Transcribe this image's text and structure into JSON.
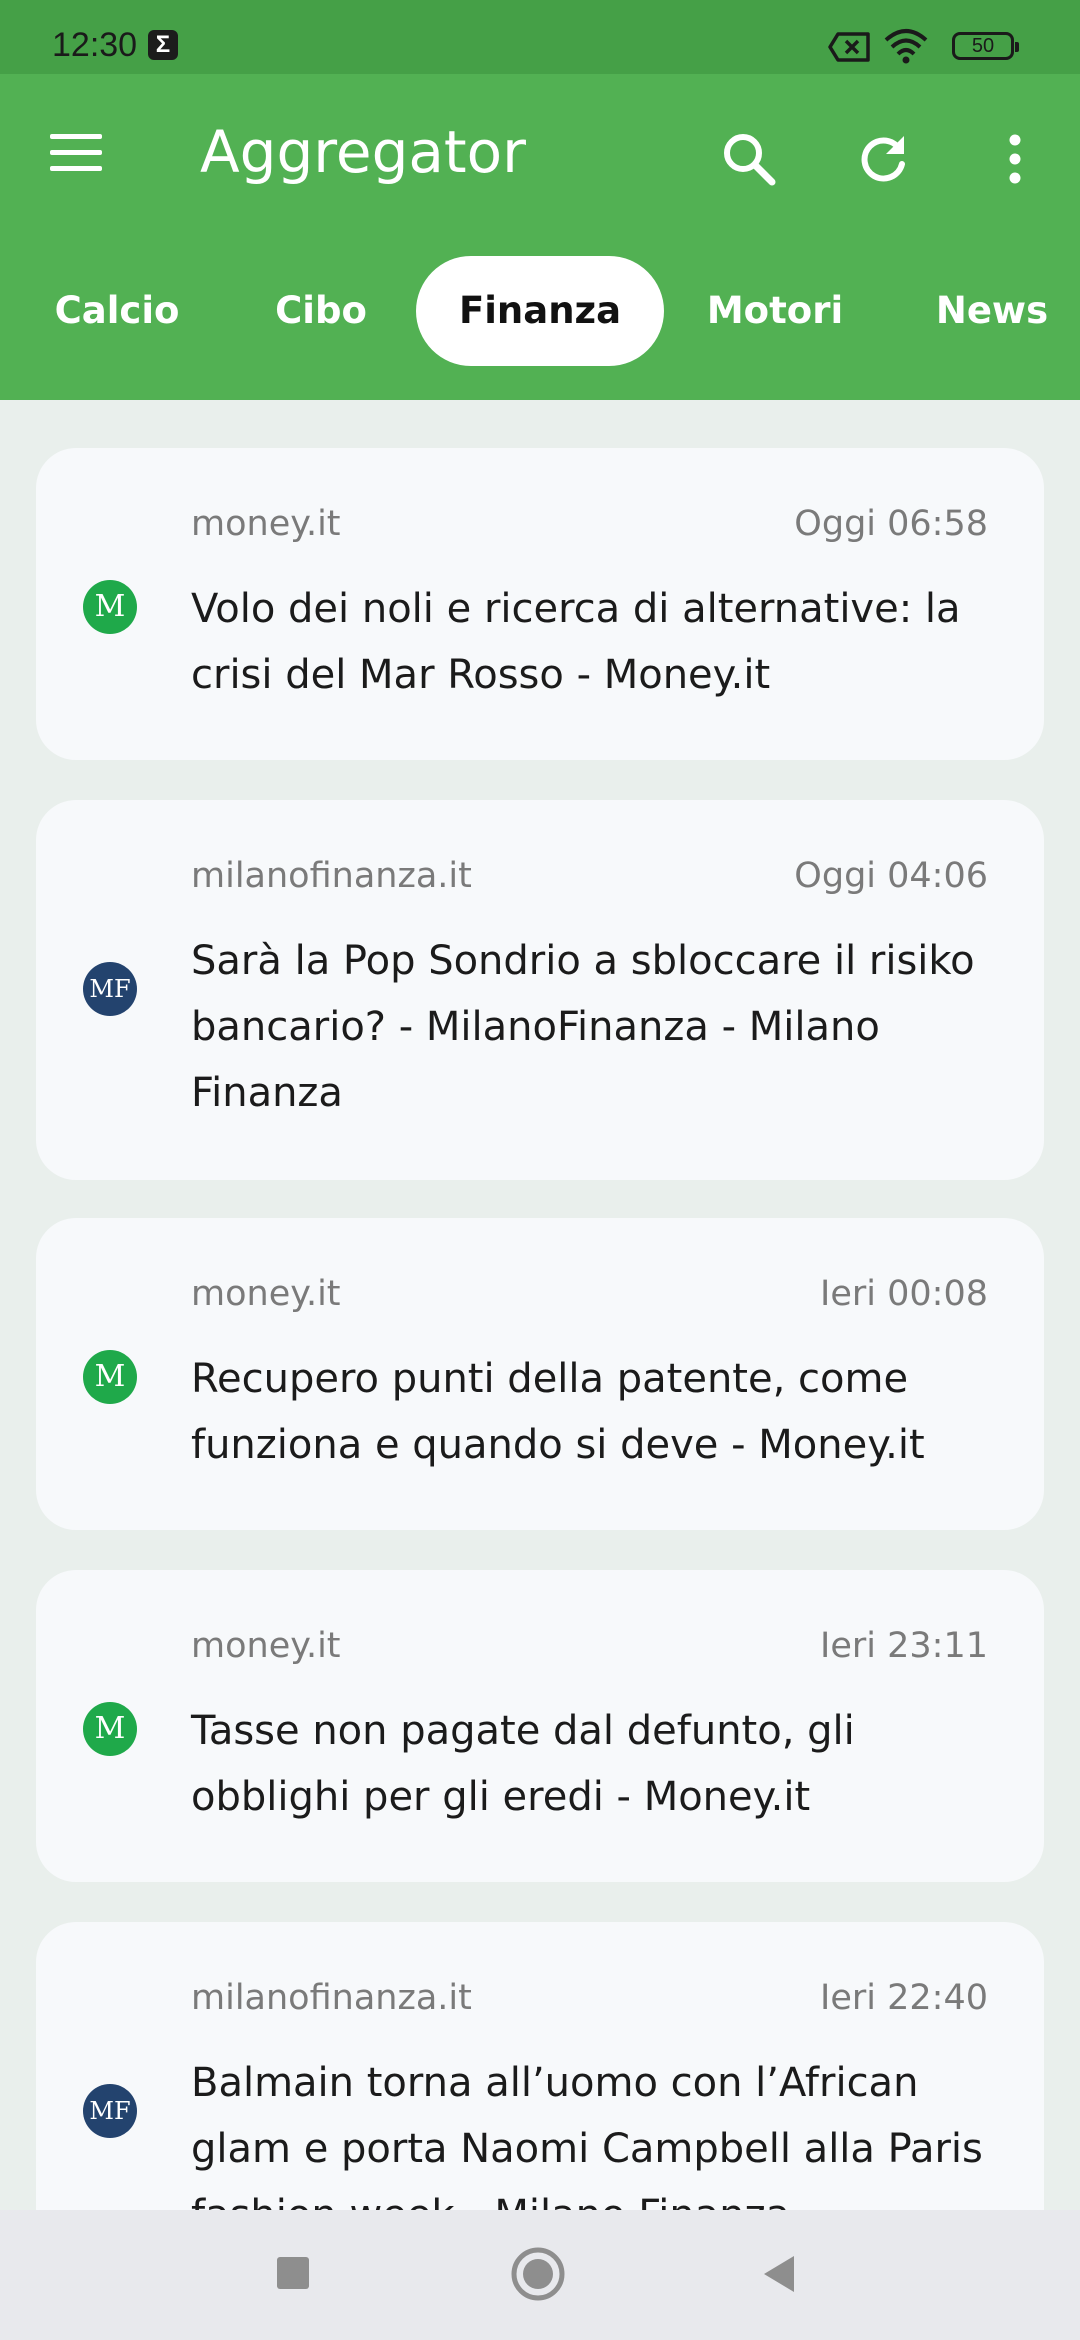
{
  "status_bar": {
    "time": "12:30",
    "battery": "50"
  },
  "app_bar": {
    "title": "Aggregator"
  },
  "tabs": [
    {
      "label": "Calcio",
      "selected": false
    },
    {
      "label": "Cibo",
      "selected": false
    },
    {
      "label": "Finanza",
      "selected": true
    },
    {
      "label": "Motori",
      "selected": false
    },
    {
      "label": "News",
      "selected": false
    }
  ],
  "articles": [
    {
      "source": "money.it",
      "date": "Oggi 06:58",
      "title": "Volo dei noli e ricerca di alternative: la crisi del Mar Rosso - Money.it",
      "logo": "M"
    },
    {
      "source": "milanofinanza.it",
      "date": "Oggi 04:06",
      "title": "Sarà la Pop Sondrio a sbloccare il risiko bancario? - MilanoFinanza - Milano Finanza",
      "logo": "MF"
    },
    {
      "source": "money.it",
      "date": "Ieri 00:08",
      "title": "Recupero punti della patente, come funziona e quando si deve - Money.it",
      "logo": "M"
    },
    {
      "source": "money.it",
      "date": "Ieri 23:11",
      "title": "Tasse non pagate dal defunto, gli obblighi per gli eredi - Money.it",
      "logo": "M"
    },
    {
      "source": "milanofinanza.it",
      "date": "Ieri 22:40",
      "title": "Balmain torna all’uomo con l’African glam e porta Naomi Campbell alla Paris fashion week - Milano Finanza",
      "logo": "MF"
    }
  ],
  "colors": {
    "app_bar": "#52b153",
    "status_bar": "#45a047",
    "money_logo": "#1fa94a",
    "mf_logo": "#23436e"
  }
}
